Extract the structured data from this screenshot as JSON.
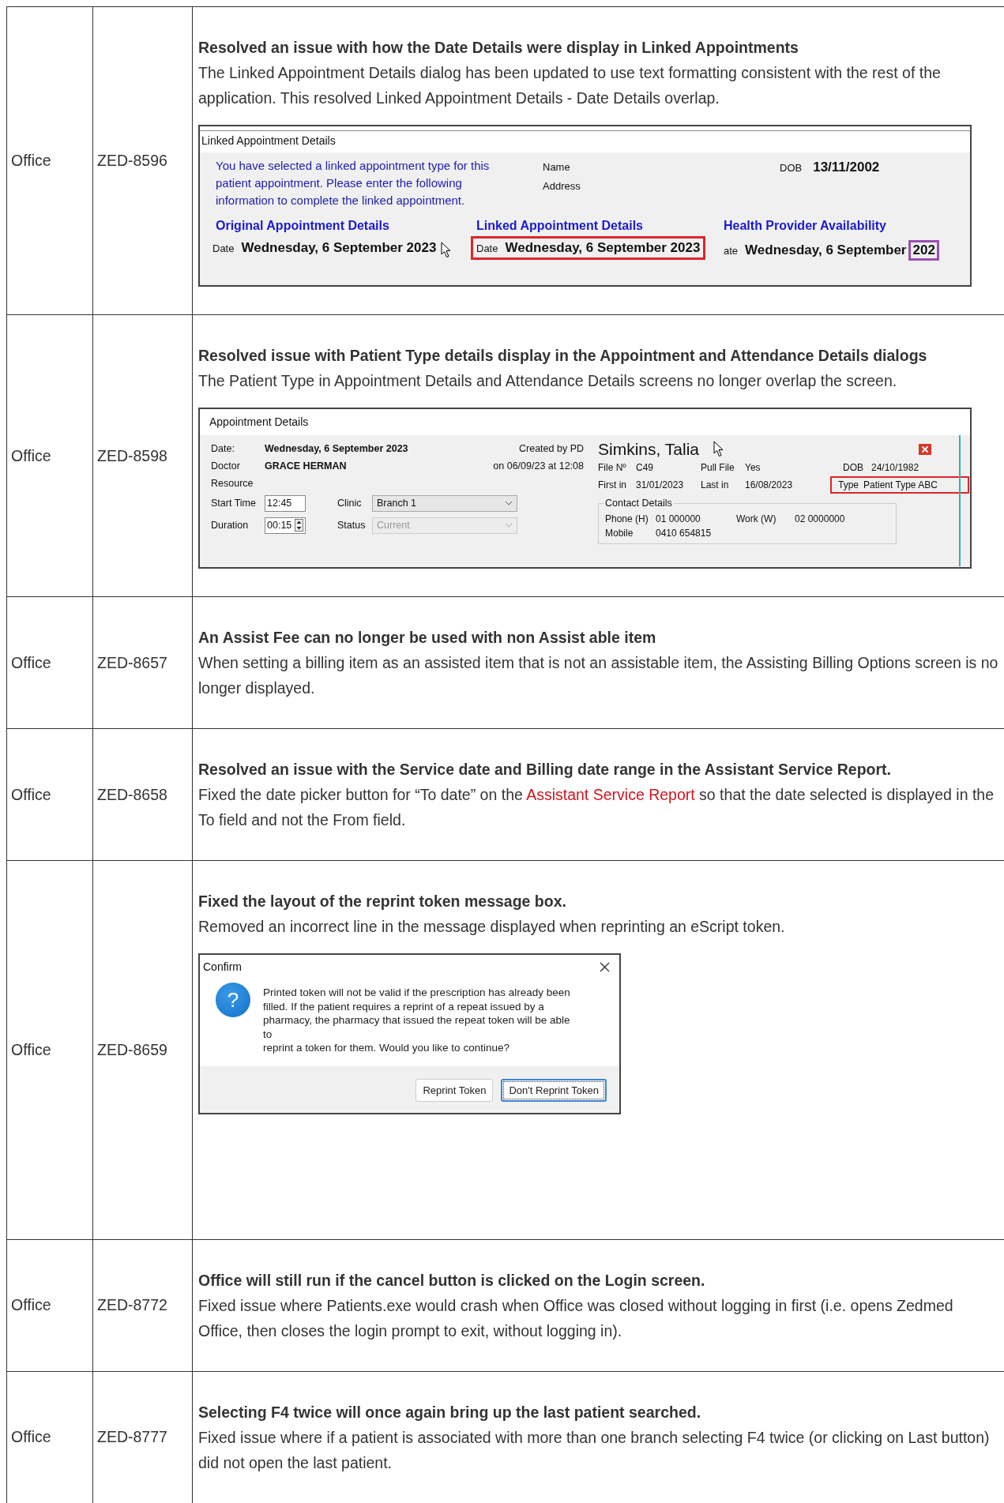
{
  "release_notes": [
    {
      "product": "Office",
      "ticket": "ZED-8596",
      "title": "Resolved an issue with how the Date Details were display in Linked Appointments",
      "description": [
        {
          "text": "The Linked Appointment Details dialog has been updated to use text formatting consistent with the rest of the application. This resolved Linked Appointment Details - Date Details overlap."
        }
      ],
      "figure": {
        "kind": "linked_appointment",
        "title": "Linked Appointment Details",
        "intro": "You have selected a linked appointment type for this patient appointment. Please enter the following information to complete the linked appointment.",
        "name_label": "Name",
        "address_label": "Address",
        "dob_label": "DOB",
        "dob": "13/11/2002",
        "sections": [
          {
            "heading": "Original Appointment Details",
            "date_label": "Date",
            "date": "Wednesday, 6 September 2023",
            "boxed": false
          },
          {
            "heading": "Linked Appointment Details",
            "date_label": "Date",
            "date": "Wednesday, 6 September 2023",
            "boxed": true,
            "color": "#e0242a"
          },
          {
            "heading": "Health Provider Availability",
            "date_label": "ate",
            "date": "Wednesday, 6 September",
            "date_end": "202",
            "boxed": false,
            "end_boxed": true,
            "color": "#9b4fb0"
          }
        ]
      }
    },
    {
      "product": "Office",
      "ticket": "ZED-8598",
      "title": "Resolved issue with Patient Type details display in the Appointment and Attendance Details dialogs",
      "description": [
        {
          "text": "The Patient Type in Appointment Details and Attendance Details screens no longer overlap the screen."
        }
      ],
      "figure": {
        "kind": "appointment_details",
        "title": "Appointment Details",
        "date_label": "Date:",
        "date": "Wednesday, 6 September 2023",
        "created_by": "Created by PD",
        "doctor_label": "Doctor",
        "doctor": "GRACE HERMAN",
        "created_on": "on 06/09/23 at 12:08",
        "resource_label": "Resource",
        "start_label": "Start Time",
        "start_time": "12:45",
        "clinic_label": "Clinic",
        "clinic": "Branch 1",
        "duration_label": "Duration",
        "duration": "00:15",
        "status_label": "Status",
        "status": "Current",
        "status_disabled": true,
        "patient_name": "Simkins, Talia",
        "file_label": "File Nº",
        "file_no": "C49",
        "pull_label": "Pull File",
        "pull_file": "Yes",
        "dob_label": "DOB",
        "dob": "24/10/1982",
        "first_label": "First in",
        "first_in": "31/01/2023",
        "last_label": "Last in",
        "last_in": "16/08/2023",
        "type_label": "Type",
        "type": "Patient Type ABC",
        "type_highlighted": true,
        "contact_title": "Contact Details",
        "phone_label": "Phone (H)",
        "phone": "01 000000",
        "work_label": "Work (W)",
        "work": "02 0000000",
        "mobile_label": "Mobile",
        "mobile": "0410 654815"
      }
    },
    {
      "product": "Office",
      "ticket": "ZED-8657",
      "title": "An Assist Fee can no longer be used with non Assist able item",
      "description": [
        {
          "text": "When setting a billing item as an assisted item that is not an assistable item, the Assisting Billing Options screen is no longer displayed."
        }
      ]
    },
    {
      "product": "Office",
      "ticket": "ZED-8658",
      "title": "Resolved an issue with the Service date and Billing date range in the Assistant Service Report.",
      "description": [
        {
          "text": "Fixed the date picker button for “To date” on the "
        },
        {
          "text": "Assistant Service Report",
          "kind": "link"
        },
        {
          "text": " so that the date selected is displayed in the To field and not the From field."
        }
      ]
    },
    {
      "product": "Office",
      "ticket": "ZED-8659",
      "title": "Fixed the layout of the reprint token message box.",
      "description": [
        {
          "text": "Removed an incorrect line in the message displayed when reprinting an eScript token."
        }
      ],
      "figure": {
        "kind": "confirm_dialog",
        "title": "Confirm",
        "icon_glyph": "?",
        "message": "Printed token will not be valid if the prescription has already been\nfilled. If the patient requires a reprint of a repeat issued by a\npharmacy, the pharmacy that issued the repeat token will be able\nto\nreprint a token for them. Would you like to continue?",
        "buttons": [
          {
            "label": "Reprint Token",
            "default": false
          },
          {
            "label": "Don't Reprint Token",
            "default": true
          }
        ]
      }
    },
    {
      "product": "Office",
      "ticket": "ZED-8772",
      "title": "Office will still run if the cancel button is clicked on the Login screen.",
      "description": [
        {
          "text": "Fixed issue where Patients.exe would crash when Office was closed without logging in first (i.e. opens Zedmed Office, then closes the login prompt to exit, without logging in)."
        }
      ]
    },
    {
      "product": "Office",
      "ticket": "ZED-8777",
      "title": "Selecting F4 twice will once again bring up the last patient searched.",
      "description": [
        {
          "text": "Fixed issue where if a patient is associated with more than one branch selecting F4 twice (or clicking on Last button) did not open the last patient."
        }
      ]
    }
  ]
}
